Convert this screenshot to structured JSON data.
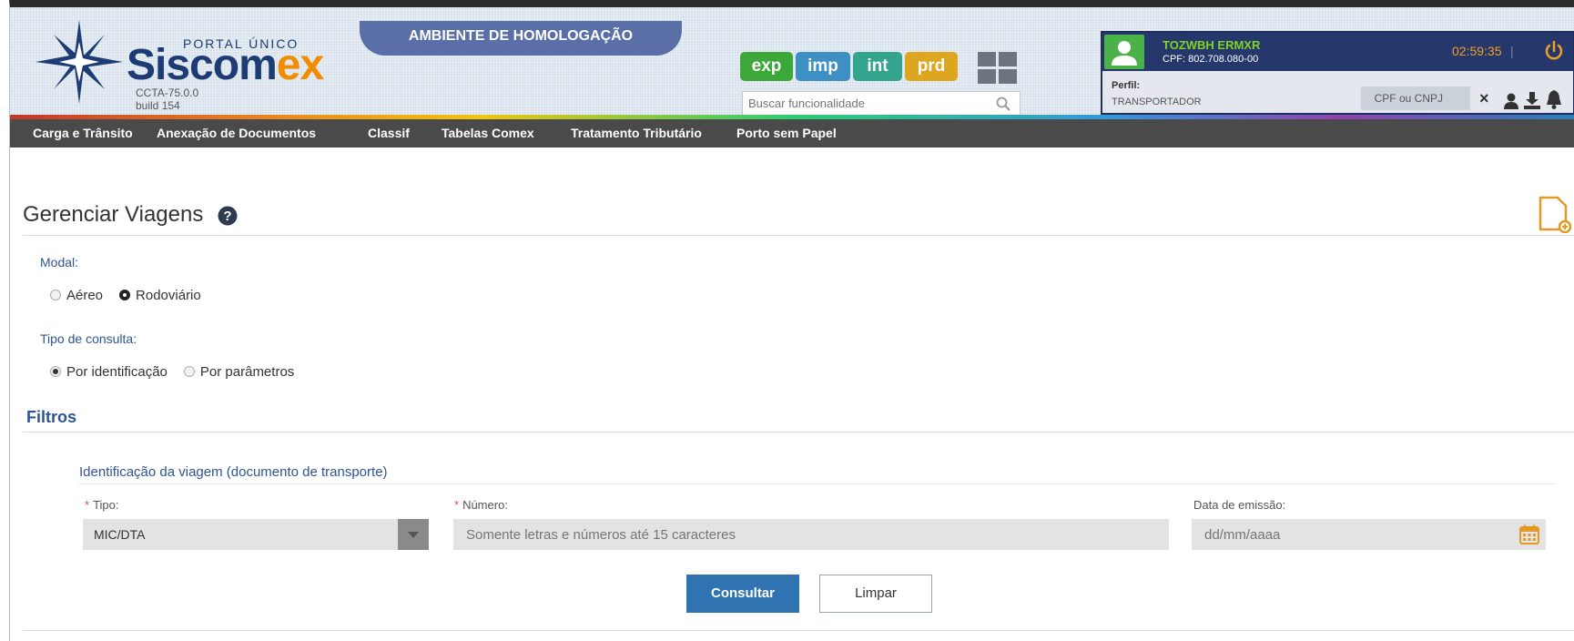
{
  "header": {
    "portal": "PORTAL ÚNICO",
    "logo_main": "Siscom",
    "logo_accent": "ex",
    "version": "CCTA-75.0.0",
    "build": "build 154",
    "environment": "AMBIENTE DE HOMOLOGAÇÃO",
    "env_buttons": [
      "exp",
      "imp",
      "int",
      "prd"
    ],
    "search_placeholder": "Buscar funcionalidade"
  },
  "user": {
    "name": "TOZWBH ERMXR",
    "cpf": "CPF: 802.708.080-00",
    "timer": "02:59:35",
    "timer_separator": "|",
    "perfil_label": "Perfil:",
    "perfil_value": "TRANSPORTADOR",
    "cnpj_placeholder": "CPF ou CNPJ",
    "clear": "×"
  },
  "nav": {
    "items": [
      "Carga e Trânsito",
      "Anexação de Documentos",
      "Classif",
      "Tabelas Comex",
      "Tratamento Tributário",
      "Porto sem Papel"
    ]
  },
  "page": {
    "title": "Gerenciar Viagens",
    "modal_label": "Modal:",
    "modal_options": [
      "Aéreo",
      "Rodoviário"
    ],
    "modal_selected": "Rodoviário",
    "tipo_consulta_label": "Tipo de consulta:",
    "tipo_options": [
      "Por identificação",
      "Por parâmetros"
    ],
    "tipo_selected": "Por identificação",
    "filtros": "Filtros",
    "sub_title": "Identificação da viagem (documento de transporte)",
    "fields": {
      "tipo_label": "Tipo:",
      "tipo_value": "MIC/DTA",
      "numero_label": "Número:",
      "numero_placeholder": "Somente letras e números até 15 caracteres",
      "data_label": "Data de emissão:",
      "data_placeholder": "dd/mm/aaaa",
      "required_mark": "*"
    },
    "buttons": {
      "consultar": "Consultar",
      "limpar": "Limpar"
    }
  },
  "colors": {
    "accent": "#2f73b0",
    "brand": "#1d3b74",
    "brand_accent": "#f28c00",
    "env_exp": "#3da83a",
    "env_imp": "#3d8fc4",
    "env_int": "#33a58f",
    "env_prd": "#dca621"
  }
}
